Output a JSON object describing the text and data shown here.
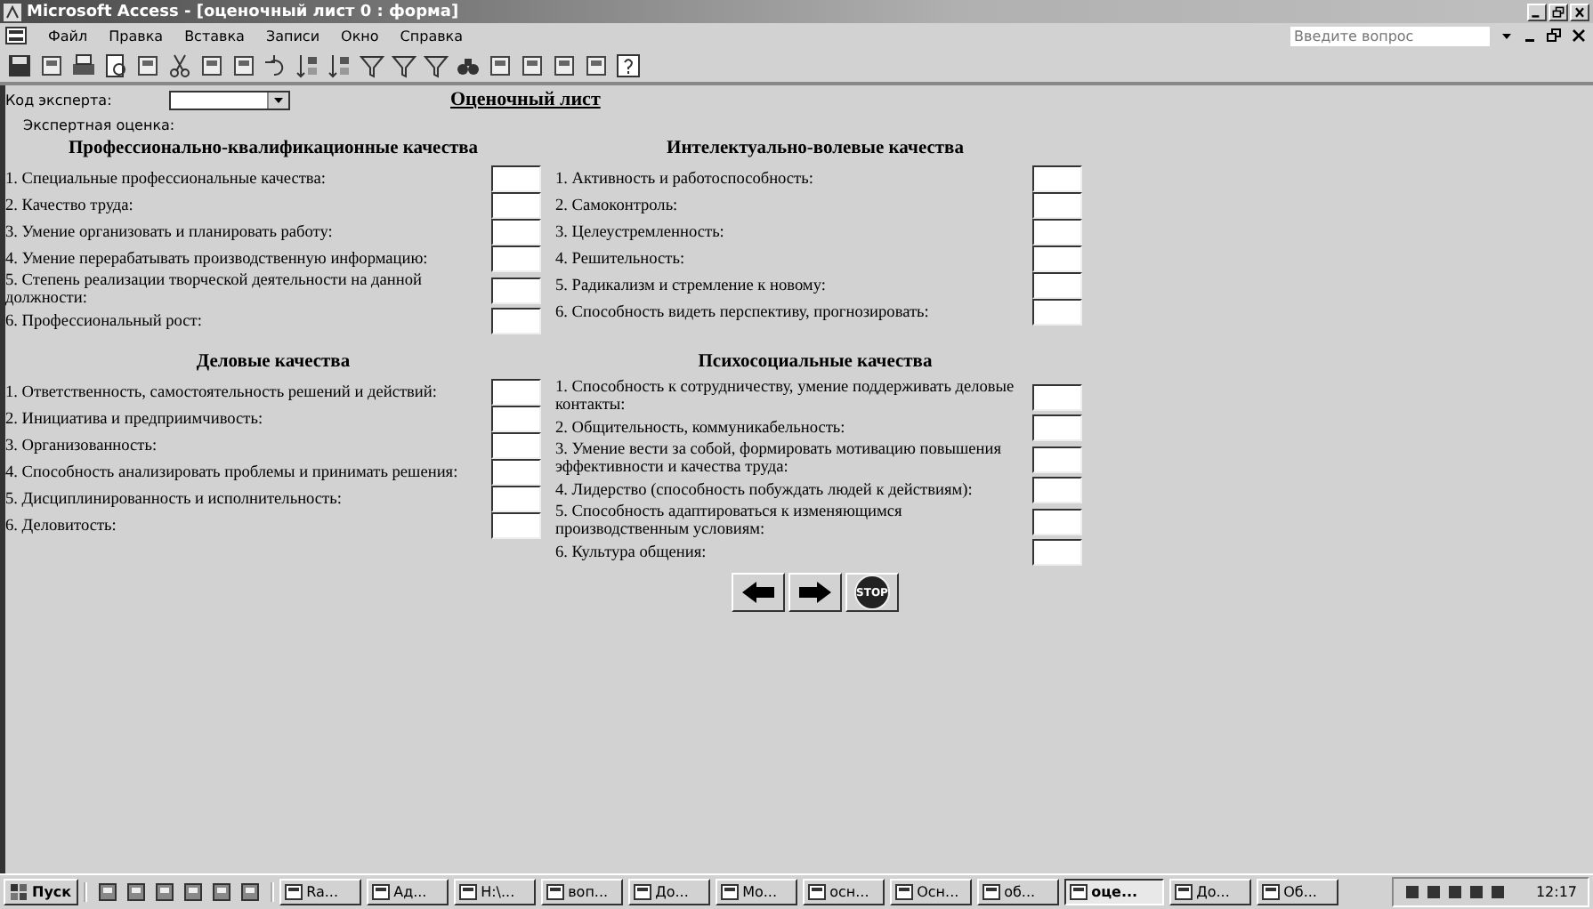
{
  "window": {
    "title": "Microsoft Access - [оценочный лист 0 : форма]"
  },
  "menu": [
    "Файл",
    "Правка",
    "Вставка",
    "Записи",
    "Окно",
    "Справка"
  ],
  "help_box": {
    "placeholder": "Введите вопрос"
  },
  "form": {
    "expert_code_label": "Код эксперта:",
    "title": "Оценочный лист",
    "expert_rating_label": "Экспертная оценка:",
    "sections": [
      {
        "title": "Профессионально-квалификационные качества",
        "items": [
          "1. Специальные профессиональные качества:",
          "2. Качество труда:",
          "3. Умение организовать и планировать работу:",
          "4. Умение перерабатывать производственную информацию:",
          "5. Степень реализации творческой деятельности на данной должности:",
          "6. Профессиональный рост:"
        ]
      },
      {
        "title": "Интелектуально-волевые качества",
        "items": [
          "1. Активность и работоспособность:",
          "2. Самоконтроль:",
          "3. Целеустремленность:",
          "4. Решительность:",
          "5. Радикализм и стремление к новому:",
          "6. Способность видеть перспективу, прогнозировать:"
        ]
      },
      {
        "title": "Деловые качества",
        "items": [
          "1. Ответственность, самостоятельность решений и действий:",
          "2. Инициатива и предприимчивость:",
          "3. Организованность:",
          "4. Способность анализировать проблемы и принимать решения:",
          "5. Дисциплинированность и исполнительность:",
          "6. Деловитость:"
        ]
      },
      {
        "title": "Психосоциальные качества",
        "items": [
          "1. Способность к сотрудничеству, умение поддерживать деловые контакты:",
          "2. Общительность, коммуникабельность:",
          "3. Умение вести за собой, формировать мотивацию повышения эффективности и качества труда:",
          "4. Лидерство (способность побуждать людей к действиям):",
          "5. Способность адаптироваться к изменяющимся производственным условиям:",
          "6. Культура общения:"
        ]
      }
    ],
    "stop_label": "STOP"
  },
  "taskbar": {
    "start": "Пуск",
    "tasks": [
      {
        "label": "Ra...",
        "selected": false
      },
      {
        "label": "Ад...",
        "selected": false
      },
      {
        "label": "H:\\...",
        "selected": false
      },
      {
        "label": "воп...",
        "selected": false
      },
      {
        "label": "До...",
        "selected": false
      },
      {
        "label": "Мо...",
        "selected": false
      },
      {
        "label": "осн...",
        "selected": false
      },
      {
        "label": "Осн...",
        "selected": false
      },
      {
        "label": "об...",
        "selected": false
      },
      {
        "label": "оце...",
        "selected": true
      },
      {
        "label": "До...",
        "selected": false
      },
      {
        "label": "Об...",
        "selected": false
      }
    ],
    "clock": "12:17"
  }
}
